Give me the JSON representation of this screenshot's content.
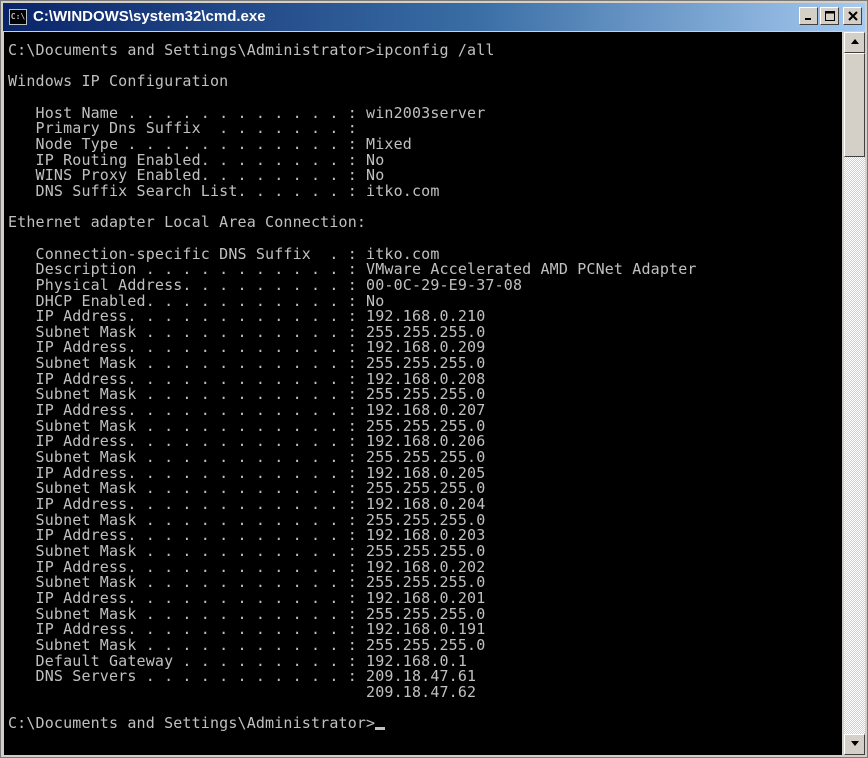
{
  "window": {
    "title": "C:\\WINDOWS\\system32\\cmd.exe",
    "icon": "cmd-console-icon",
    "icon_label": "C:\\"
  },
  "controls": {
    "minimize_icon": "minimize-icon",
    "maximize_icon": "maximize-icon",
    "close_icon": "close-icon"
  },
  "console": {
    "lines": [
      "C:\\Documents and Settings\\Administrator>ipconfig /all",
      "",
      "Windows IP Configuration",
      "",
      "   Host Name . . . . . . . . . . . . : win2003server",
      "   Primary Dns Suffix  . . . . . . . :",
      "   Node Type . . . . . . . . . . . . : Mixed",
      "   IP Routing Enabled. . . . . . . . : No",
      "   WINS Proxy Enabled. . . . . . . . : No",
      "   DNS Suffix Search List. . . . . . : itko.com",
      "",
      "Ethernet adapter Local Area Connection:",
      "",
      "   Connection-specific DNS Suffix  . : itko.com",
      "   Description . . . . . . . . . . . : VMware Accelerated AMD PCNet Adapter",
      "   Physical Address. . . . . . . . . : 00-0C-29-E9-37-08",
      "   DHCP Enabled. . . . . . . . . . . : No",
      "   IP Address. . . . . . . . . . . . : 192.168.0.210",
      "   Subnet Mask . . . . . . . . . . . : 255.255.255.0",
      "   IP Address. . . . . . . . . . . . : 192.168.0.209",
      "   Subnet Mask . . . . . . . . . . . : 255.255.255.0",
      "   IP Address. . . . . . . . . . . . : 192.168.0.208",
      "   Subnet Mask . . . . . . . . . . . : 255.255.255.0",
      "   IP Address. . . . . . . . . . . . : 192.168.0.207",
      "   Subnet Mask . . . . . . . . . . . : 255.255.255.0",
      "   IP Address. . . . . . . . . . . . : 192.168.0.206",
      "   Subnet Mask . . . . . . . . . . . : 255.255.255.0",
      "   IP Address. . . . . . . . . . . . : 192.168.0.205",
      "   Subnet Mask . . . . . . . . . . . : 255.255.255.0",
      "   IP Address. . . . . . . . . . . . : 192.168.0.204",
      "   Subnet Mask . . . . . . . . . . . : 255.255.255.0",
      "   IP Address. . . . . . . . . . . . : 192.168.0.203",
      "   Subnet Mask . . . . . . . . . . . : 255.255.255.0",
      "   IP Address. . . . . . . . . . . . : 192.168.0.202",
      "   Subnet Mask . . . . . . . . . . . : 255.255.255.0",
      "   IP Address. . . . . . . . . . . . : 192.168.0.201",
      "   Subnet Mask . . . . . . . . . . . : 255.255.255.0",
      "   IP Address. . . . . . . . . . . . : 192.168.0.191",
      "   Subnet Mask . . . . . . . . . . . : 255.255.255.0",
      "   Default Gateway . . . . . . . . . : 192.168.0.1",
      "   DNS Servers . . . . . . . . . . . : 209.18.47.61",
      "                                       209.18.47.62",
      ""
    ],
    "prompt": "C:\\Documents and Settings\\Administrator>"
  },
  "colors": {
    "console_background": "#000000",
    "console_text": "#c0c0c0",
    "titlebar_start": "#0a246a",
    "titlebar_end": "#a6caf0"
  }
}
